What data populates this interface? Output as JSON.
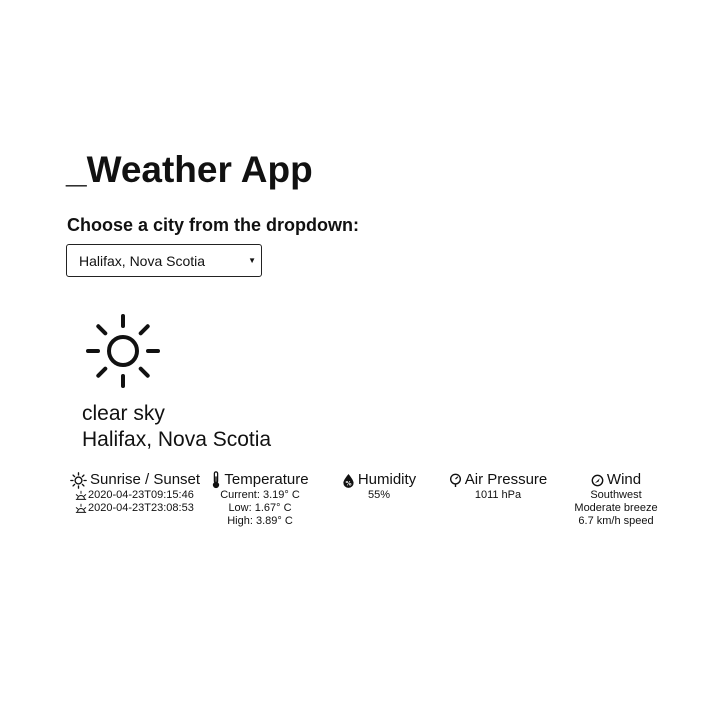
{
  "app": {
    "title": "_Weather App",
    "choose_label": "Choose a city from the dropdown:"
  },
  "city_select": {
    "selected": "Halifax, Nova Scotia"
  },
  "current": {
    "icon": "sun-icon",
    "condition": "clear sky",
    "location": "Halifax, Nova Scotia"
  },
  "stats": {
    "sun": {
      "label": "Sunrise / Sunset",
      "sunrise": "2020-04-23T09:15:46",
      "sunset": "2020-04-23T23:08:53"
    },
    "temperature": {
      "label": "Temperature",
      "current": "Current: 3.19° C",
      "low": "Low: 1.67° C",
      "high": "High: 3.89° C"
    },
    "humidity": {
      "label": "Humidity",
      "value": "55%"
    },
    "pressure": {
      "label": "Air Pressure",
      "value": "1011 hPa"
    },
    "wind": {
      "label": "Wind",
      "direction": "Southwest",
      "description": "Moderate breeze",
      "speed": "6.7 km/h speed"
    }
  }
}
